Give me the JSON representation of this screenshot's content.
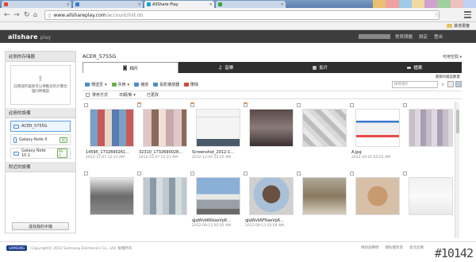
{
  "browser": {
    "tabs": [
      {
        "title": "",
        "color": "#e04a3a",
        "active": false
      },
      {
        "title": "",
        "color": "#3a7ad0",
        "active": false
      },
      {
        "title": "AllShare Play",
        "color": "#1aa0e0",
        "active": true
      },
      {
        "title": "",
        "color": "#3aa83a",
        "active": false
      }
    ],
    "url_host": "www.allshareplay.com",
    "url_path": "/account/init.do",
    "bookmark_folder": "其他書籤"
  },
  "header": {
    "logo_main": "allshare",
    "logo_sub": "play",
    "links": [
      "常見問題",
      "設定",
      "登出"
    ]
  },
  "sidebar": {
    "storage_title": "註冊的存储器",
    "drop_hint": "註冊儲存器後可以彈動您的計畫合理同時檔案",
    "devices_title": "註冊的設備",
    "devices": [
      {
        "name": "ACER_5755G",
        "badge": "",
        "selected": true
      },
      {
        "name": "Galaxy Note II",
        "badge": "3G",
        "selected": false
      },
      {
        "name": "Galaxy Note 10.1",
        "badge": "Wi-Fi",
        "selected": false
      }
    ],
    "nearby_title": "附近的設備",
    "find_button": "尋找我的手機"
  },
  "main": {
    "device": "ACER_5755G",
    "sort_select": "可用空間",
    "tabs": [
      {
        "label": "相片",
        "icon": "camera-icon",
        "active": true
      },
      {
        "label": "音樂",
        "icon": "music-icon",
        "active": false
      },
      {
        "label": "影片",
        "icon": "film-icon",
        "active": false
      },
      {
        "label": "檔案",
        "icon": "folder-icon",
        "active": false
      }
    ],
    "select_all": "選擇的檔案數量",
    "actions": [
      {
        "label": "傳送至",
        "icon": "send-icon",
        "color": "#4a8ad0"
      },
      {
        "label": "共用",
        "icon": "share-icon",
        "color": "#6ab04c"
      },
      {
        "label": "播放",
        "icon": "play-icon",
        "color": "#4a8ad0"
      },
      {
        "label": "投影播放器",
        "icon": "slideshow-icon",
        "color": "#4a8ad0"
      },
      {
        "label": "刪除",
        "icon": "delete-icon",
        "color": "#d04a3a"
      }
    ],
    "search_placeholder": "搜尋相片",
    "sortbar": [
      "排序方式",
      "日期/新",
      "已更改"
    ],
    "photos": [
      {
        "name": "14595_1732690261...",
        "date": "2012-12-07 12:21 AM",
        "mark": true,
        "thumb": "collage-1"
      },
      {
        "name": "32310_1732690028...",
        "date": "2012-12-07 12:21 AM",
        "mark": true,
        "thumb": "collage-2"
      },
      {
        "name": "Screenshot_2012-1...",
        "date": "2012-12-04 12:25 AM",
        "mark": true,
        "thumb": "screenshot"
      },
      {
        "name": "",
        "date": "",
        "mark": false,
        "thumb": "blur-1"
      },
      {
        "name": "",
        "date": "",
        "mark": false,
        "thumb": "blur-2"
      },
      {
        "name": "A.jpg",
        "date": "2012-10-25 05:01 AM",
        "mark": false,
        "thumb": "web"
      },
      {
        "name": "",
        "date": "",
        "mark": false,
        "thumb": "blur-3"
      },
      {
        "name": "",
        "date": "",
        "mark": false,
        "thumb": "blur-4"
      },
      {
        "name": "",
        "date": "",
        "mark": false,
        "thumb": "blur-5"
      },
      {
        "name": "qJqWvb6KkaeVp6...",
        "date": "2012-09-13 02:05 AM",
        "mark": false,
        "thumb": "building"
      },
      {
        "name": "qJqWvb6FKaeVp6...",
        "date": "2012-09-13 02:04 AM",
        "mark": false,
        "thumb": "dog"
      },
      {
        "name": "",
        "date": "",
        "mark": false,
        "thumb": "blur-6"
      },
      {
        "name": "",
        "date": "",
        "mark": false,
        "thumb": "blur-7"
      },
      {
        "name": "",
        "date": "",
        "mark": false,
        "thumb": "blur-8"
      }
    ]
  },
  "footer": {
    "brand": "SAMSUNG",
    "copyright": "Copyright© 2012 Samsung Electronics Co., Ltd. 版權所有",
    "links": [
      "條款與聲明",
      "隱私權政策",
      "意見反應"
    ]
  },
  "watermark": "#10142"
}
